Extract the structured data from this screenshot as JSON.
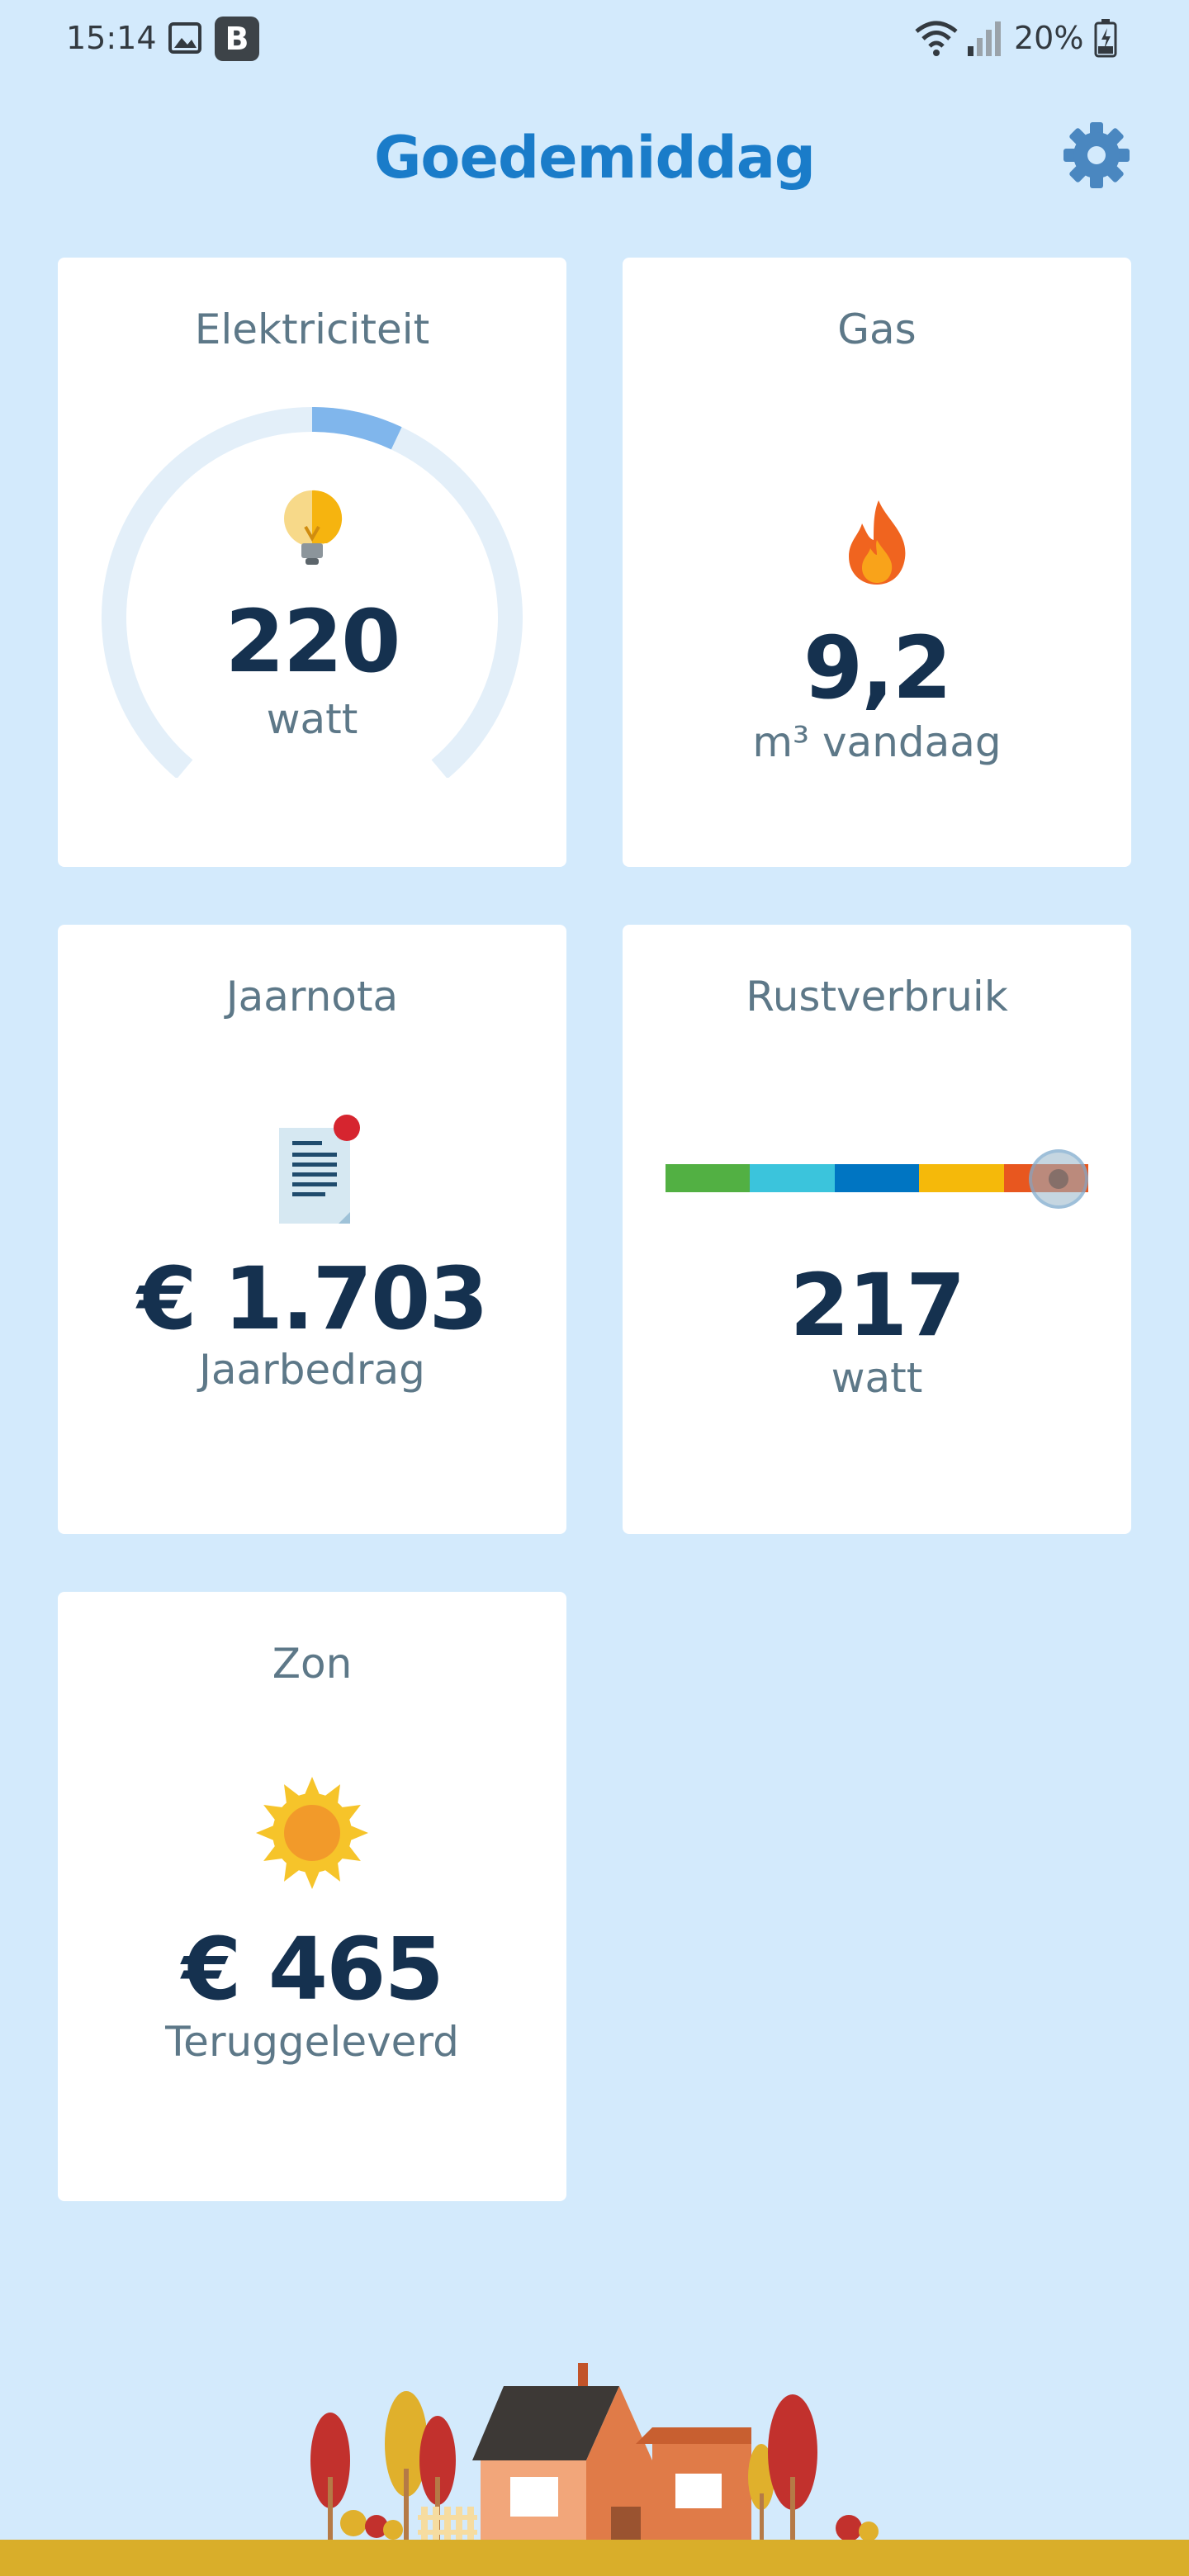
{
  "status_bar": {
    "time": "15:14",
    "app_badge": "B",
    "battery": "20%"
  },
  "header": {
    "title": "Goedemiddag"
  },
  "cards": {
    "electricity": {
      "title": "Elektriciteit",
      "value": "220",
      "unit": "watt",
      "gauge_fraction": 0.15
    },
    "gas": {
      "title": "Gas",
      "value": "9,2",
      "unit": "m³ vandaag"
    },
    "annual_bill": {
      "title": "Jaarnota",
      "value": "€ 1.703",
      "unit": "Jaarbedrag"
    },
    "standby": {
      "title": "Rustverbruik",
      "value": "217",
      "unit": "watt",
      "scale_colors": [
        "#52b043",
        "#3bc4dc",
        "#0075c2",
        "#f5b90a",
        "#e8571f"
      ],
      "marker_fraction": 0.93
    },
    "solar": {
      "title": "Zon",
      "value": "€ 465",
      "unit": "Teruggeleverd"
    }
  },
  "colors": {
    "background": "#d3eafc",
    "accent": "#1a7cc9",
    "value_text": "#15314f",
    "label_text": "#5d7888"
  }
}
